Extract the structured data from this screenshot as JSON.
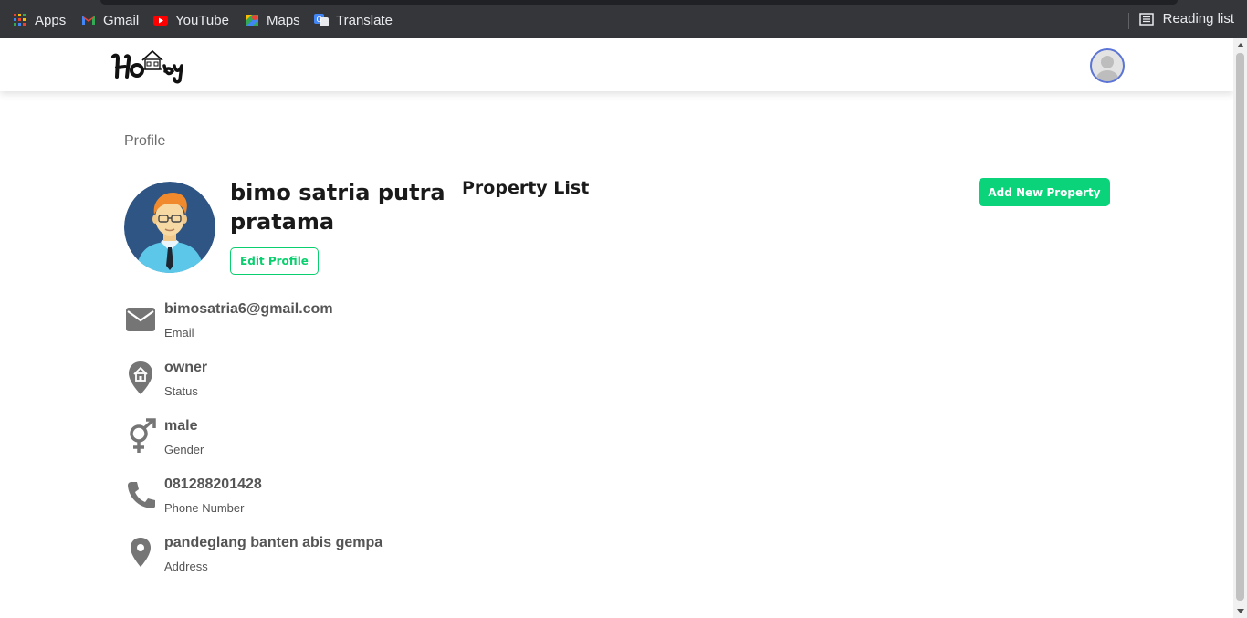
{
  "browser": {
    "bookmarks": [
      {
        "label": "Apps",
        "icon": "apps-grid-icon"
      },
      {
        "label": "Gmail",
        "icon": "gmail-icon"
      },
      {
        "label": "YouTube",
        "icon": "youtube-icon"
      },
      {
        "label": "Maps",
        "icon": "maps-icon"
      },
      {
        "label": "Translate",
        "icon": "translate-icon"
      }
    ],
    "reading_list": "Reading list"
  },
  "page": {
    "breadcrumb": "Profile",
    "user": {
      "name": "bimo satria putra pratama",
      "edit_label": "Edit Profile"
    },
    "property": {
      "title": "Property List",
      "add_label": "Add New Property"
    },
    "details": [
      {
        "value": "bimosatria6@gmail.com",
        "label": "Email",
        "icon": "mail-icon"
      },
      {
        "value": "owner",
        "label": "Status",
        "icon": "home-pin-icon"
      },
      {
        "value": "male",
        "label": "Gender",
        "icon": "gender-icon"
      },
      {
        "value": "081288201428",
        "label": "Phone Number",
        "icon": "phone-icon"
      },
      {
        "value": "pandeglang banten abis gempa",
        "label": "Address",
        "icon": "location-pin-icon"
      }
    ]
  },
  "colors": {
    "accent": "#0acf6f",
    "bookmarks_bg": "#35363a",
    "icon_gray": "#757575"
  }
}
